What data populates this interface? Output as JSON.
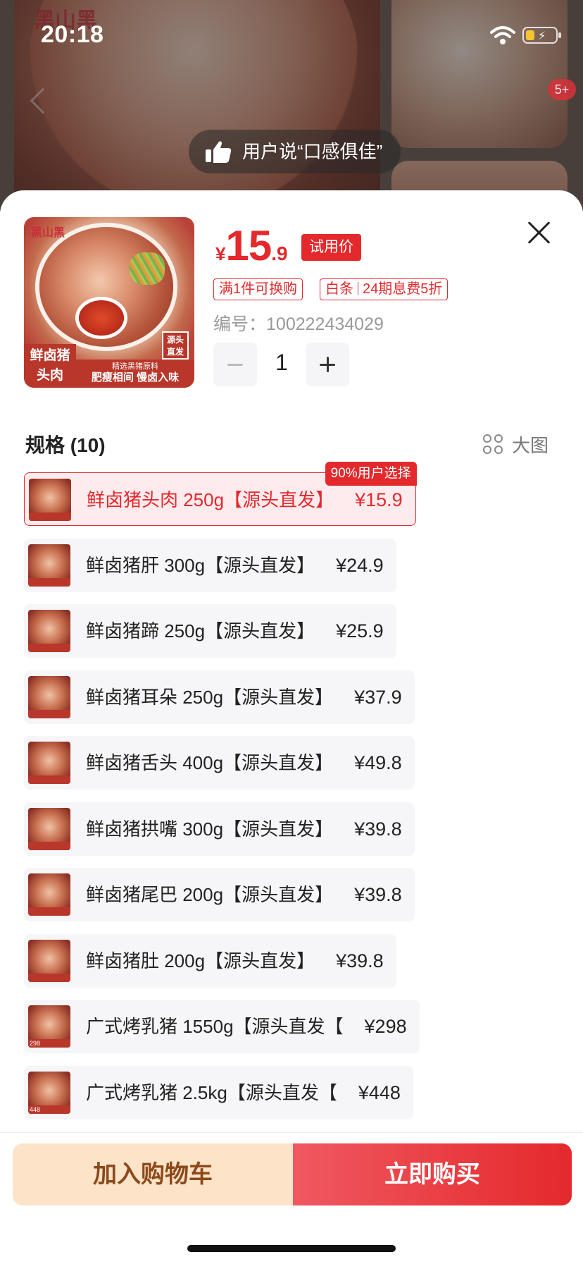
{
  "status": {
    "time": "20:18"
  },
  "background": {
    "brand": "黑山黑",
    "review": "用户说“口感俱佳”",
    "badge": "5+"
  },
  "product": {
    "image_brand": "黑山黑",
    "image_tag": "鲜卤猪头肉",
    "image_strip_small": "精选黑猪原料",
    "image_strip": "肥瘦相间 慢卤入味",
    "image_src_badge": "源头直发",
    "price_symbol": "¥",
    "price_int": "15",
    "price_dec": ".9",
    "price_badge": "试用价",
    "promo_1": "满1件可换购",
    "promo_2a": "白条",
    "promo_2b": "24期息费5折",
    "sku_label": "编号：",
    "sku_number": "100222434029",
    "quantity": "1"
  },
  "spec": {
    "title": "规格 (10)",
    "big_image_label": "大图",
    "choice_badge": "90%用户选择",
    "items": [
      {
        "name": "鲜卤猪头肉 250g【源头直发】",
        "price": "¥15.9",
        "selected": true
      },
      {
        "name": "鲜卤猪肝 300g【源头直发】",
        "price": "¥24.9"
      },
      {
        "name": "鲜卤猪蹄 250g【源头直发】",
        "price": "¥25.9"
      },
      {
        "name": "鲜卤猪耳朵 250g【源头直发】",
        "price": "¥37.9"
      },
      {
        "name": "鲜卤猪舌头 400g【源头直发】",
        "price": "¥49.8"
      },
      {
        "name": "鲜卤猪拱嘴 300g【源头直发】",
        "price": "¥39.8"
      },
      {
        "name": "鲜卤猪尾巴 200g【源头直发】",
        "price": "¥39.8"
      },
      {
        "name": "鲜卤猪肚 200g【源头直发】",
        "price": "¥39.8"
      },
      {
        "name": "广式烤乳猪 1550g【源头直发【",
        "price": "¥298",
        "thumb_label": "298"
      },
      {
        "name": "广式烤乳猪 2.5kg【源头直发【",
        "price": "¥448",
        "thumb_label": "448"
      }
    ]
  },
  "actions": {
    "add_cart": "加入购物车",
    "buy_now": "立即购买"
  },
  "colors": {
    "accent": "#e4292c",
    "cart_bg": "#fde3c7",
    "cart_text": "#8b4a1c"
  }
}
